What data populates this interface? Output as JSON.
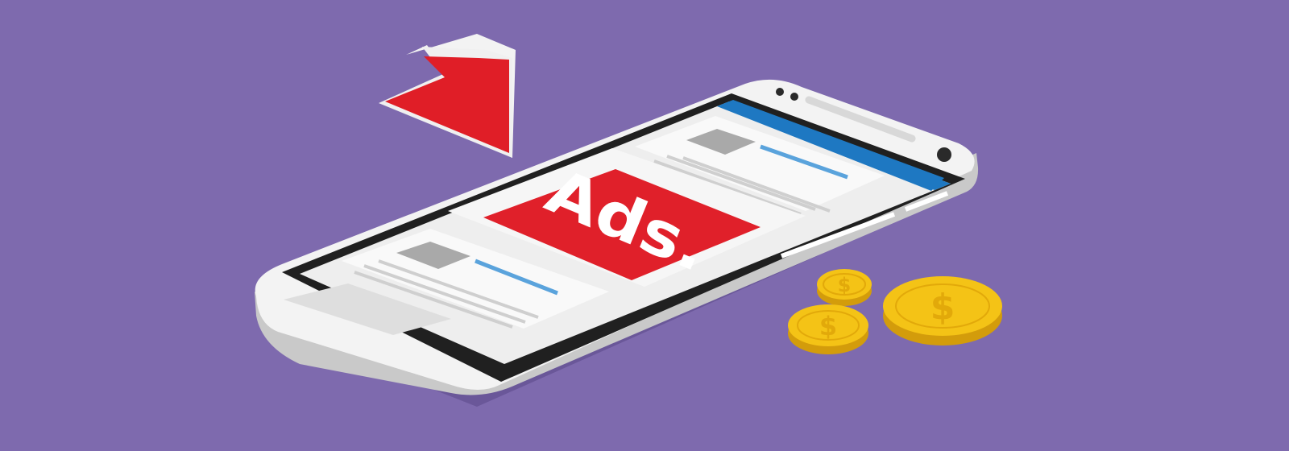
{
  "illustration": {
    "ad_label": "Ads.",
    "coins": [
      {
        "symbol": "$"
      },
      {
        "symbol": "$"
      },
      {
        "symbol": "$"
      }
    ]
  },
  "colors": {
    "background": "#7e6aae",
    "phone_body": "#f2f2f2",
    "phone_side": "#c8c8c8",
    "screen_bezel": "#1f1f1f",
    "screen_bg": "#eeeeee",
    "header_bar": "#1e78c2",
    "ad_red": "#e0202a",
    "arrow_red": "#e01e27",
    "coin_gold": "#f4c316",
    "coin_shadow": "#d39c0b",
    "link_blue": "#5aa3dc"
  },
  "icons": [
    "down-right-arrow-icon",
    "dollar-coin-icon",
    "smartphone-icon"
  ]
}
